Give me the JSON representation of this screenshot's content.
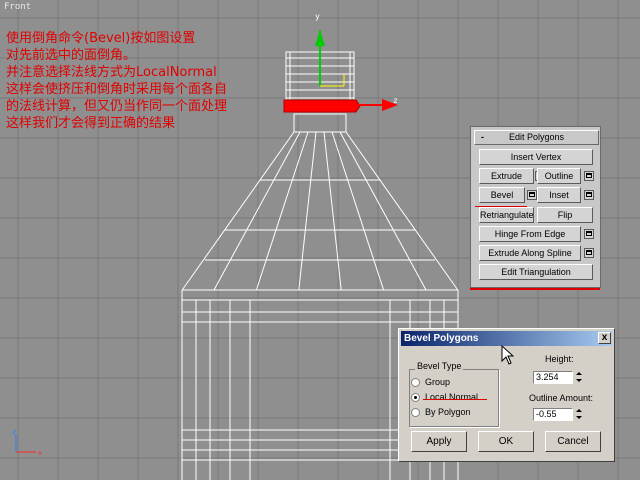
{
  "viewport": {
    "label": "Front",
    "axis_y": "y",
    "axis_z": "z"
  },
  "annotation": {
    "lines": [
      "使用倒角命令(Bevel)按如图设置",
      "对先前选中的面倒角。",
      "并注意选择法线方式为LocalNormal",
      "这样会使挤压和倒角时采用每个面各自",
      "的法线计算，但又仍当作同一个面处理",
      "这样我们才会得到正确的结果"
    ],
    "color": "#e00000"
  },
  "edit_polygons": {
    "title": "Edit Polygons",
    "collapse_symbol": "-",
    "insert_vertex": "Insert Vertex",
    "extrude": "Extrude",
    "outline": "Outline",
    "bevel": "Bevel",
    "inset": "Inset",
    "retriangulate": "Retriangulate",
    "flip": "Flip",
    "hinge_from_edge": "Hinge From Edge",
    "extrude_along_spline": "Extrude Along Spline",
    "edit_triangulation": "Edit Triangulation"
  },
  "dialog": {
    "title": "Bevel Polygons",
    "close": "x",
    "bevel_type_label": "Bevel Type",
    "options": [
      "Group",
      "Local Normal",
      "By Polygon"
    ],
    "selected": "Local Normal",
    "height_label": "Height:",
    "height_value": "3.254",
    "outline_label": "Outline Amount:",
    "outline_value": "-0.55",
    "apply": "Apply",
    "ok": "OK",
    "cancel": "Cancel"
  },
  "colors": {
    "viewport_bg": "#8f8f8f",
    "grid": "#7a7a7a",
    "wire": "#ffffff",
    "selection": "#ff0000",
    "axis_y": "#00cc00",
    "axis_z": "#ff0000"
  }
}
